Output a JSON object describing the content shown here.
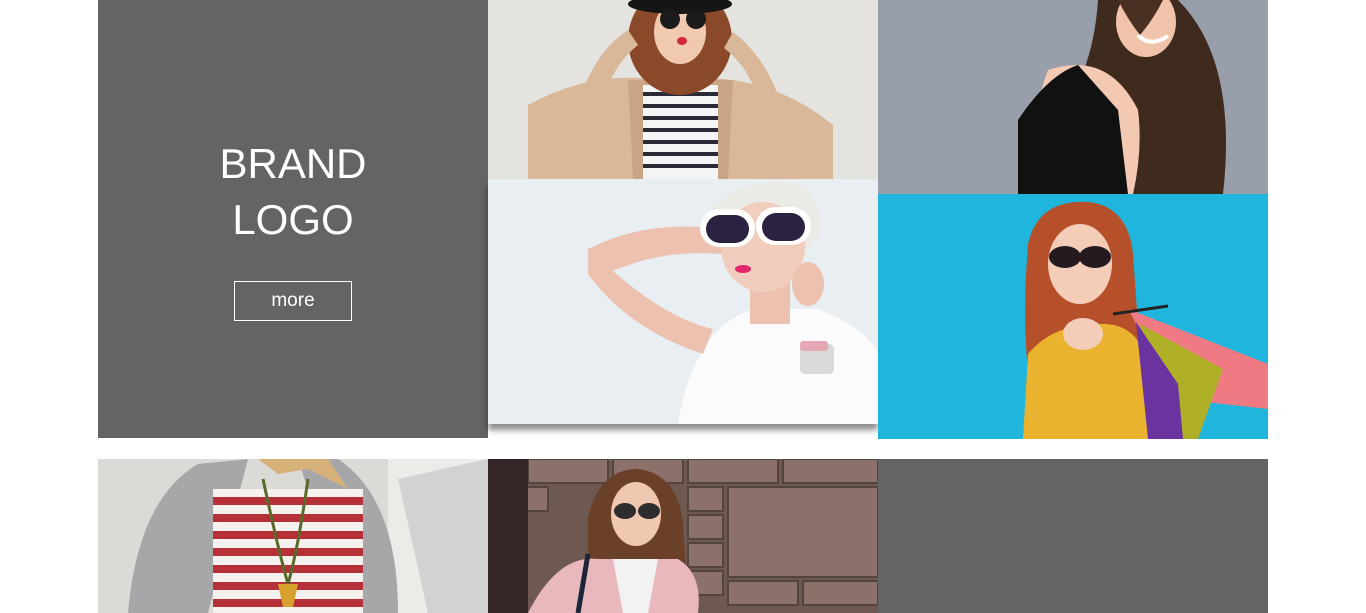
{
  "brand": {
    "logo_line1": "BRAND",
    "logo_line2": "LOGO",
    "more_label": "more"
  },
  "colors": {
    "tile_gray": "#646464",
    "photo4_background": "#1fb5dc",
    "photo3_background": "#989eaa"
  },
  "photos": [
    {
      "name": "woman-black-hat-sunglasses-beige-coat"
    },
    {
      "name": "woman-white-hair-white-sunglasses"
    },
    {
      "name": "woman-long-brown-hair-black-top"
    },
    {
      "name": "woman-red-hair-yellow-sweater-shopping-bags"
    },
    {
      "name": "woman-fur-coat-striped-shirt"
    },
    {
      "name": "woman-sunglasses-pink-jacket-brick-wall"
    }
  ]
}
